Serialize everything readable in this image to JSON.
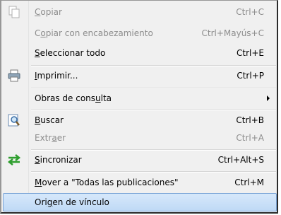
{
  "menu": {
    "items": [
      {
        "pre": "",
        "ul": "C",
        "post": "opiar",
        "shortcut": "Ctrl+C",
        "enabled": false,
        "icon": "copy-icon"
      },
      {
        "pre": "C",
        "ul": "o",
        "post": "piar con encabezamiento",
        "shortcut": "Ctrl+Mayús+C",
        "enabled": false,
        "icon": ""
      },
      {
        "pre": "",
        "ul": "S",
        "post": "eleccionar todo",
        "shortcut": "Ctrl+E",
        "enabled": true,
        "icon": ""
      },
      {
        "pre": "",
        "ul": "I",
        "post": "mprimir...",
        "shortcut": "Ctrl+P",
        "enabled": true,
        "icon": "printer-icon"
      },
      {
        "pre": "Obras de cons",
        "ul": "u",
        "post": "lta",
        "shortcut": "",
        "enabled": true,
        "icon": "",
        "submenu": true
      },
      {
        "pre": "",
        "ul": "B",
        "post": "uscar",
        "shortcut": "Ctrl+B",
        "enabled": true,
        "icon": "search-icon"
      },
      {
        "pre": "Extr",
        "ul": "a",
        "post": "er",
        "shortcut": "Ctrl+A",
        "enabled": false,
        "icon": ""
      },
      {
        "pre": "",
        "ul": "S",
        "post": "incronizar",
        "shortcut": "Ctrl+Alt+S",
        "enabled": true,
        "icon": "sync-icon"
      },
      {
        "pre": "",
        "ul": "M",
        "post": "over a \"Todas las publicaciones\"",
        "shortcut": "Ctrl+M",
        "enabled": true,
        "icon": ""
      },
      {
        "pre": "Ori",
        "ul": "g",
        "post": "en de vínculo",
        "shortcut": "",
        "enabled": true,
        "icon": "",
        "highlighted": true
      }
    ]
  },
  "colors": {
    "highlight": "#cce4f7",
    "disabled_text": "#8d8d8d",
    "sync_green": "#2e9e2e"
  }
}
